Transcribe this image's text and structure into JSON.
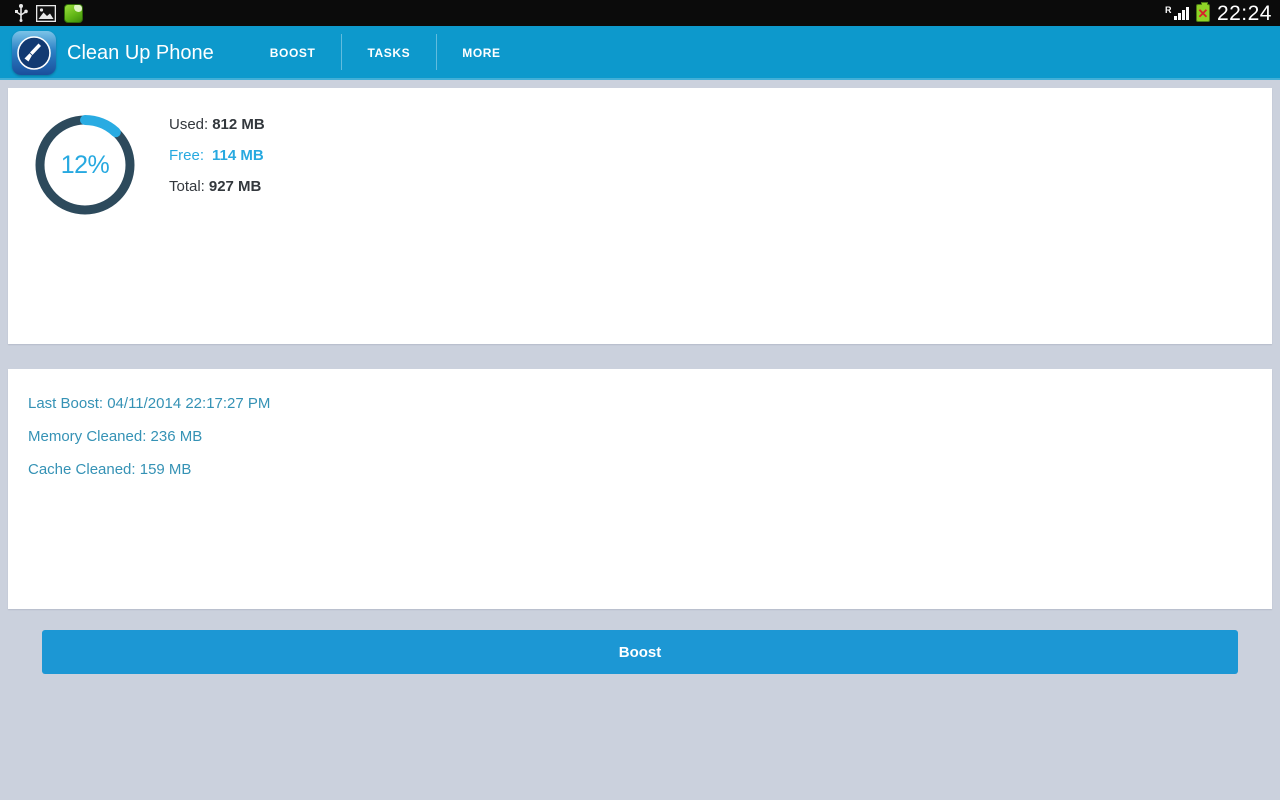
{
  "status_bar": {
    "left_icons": [
      "usb-icon",
      "gallery-image-icon",
      "green-app-icon"
    ],
    "roaming_label": "R",
    "signal_icon": "signal-bars-icon",
    "battery_icon": "battery-error-icon",
    "battery_x": "✕",
    "clock": "22:24"
  },
  "action_bar": {
    "app_icon": "broom-app-icon",
    "title": "Clean Up Phone",
    "tabs": [
      {
        "label": "BOOST"
      },
      {
        "label": "TASKS"
      },
      {
        "label": "MORE"
      }
    ],
    "background_color": "#0d99cc"
  },
  "memory_card": {
    "percent_label": "12%",
    "percent_value": 12,
    "ring_track_color": "#2d4a5c",
    "ring_progress_color": "#29abe2",
    "stats": [
      {
        "label": "Used:",
        "value": "812 MB",
        "color": "#33383d"
      },
      {
        "label": "Free:",
        "value": "114 MB",
        "color": "#27a9e0"
      },
      {
        "label": "Total:",
        "value": "927 MB",
        "color": "#33383d"
      }
    ]
  },
  "boost_info_card": {
    "lines": [
      "Last Boost: 04/11/2014 22:17:27 PM",
      "Memory Cleaned: 236 MB",
      "Cache Cleaned: 159 MB"
    ],
    "text_color": "#3592b5"
  },
  "boost_button": {
    "label": "Boost",
    "color": "#1c97d4"
  },
  "page": {
    "background_color": "#cbd1dd"
  }
}
